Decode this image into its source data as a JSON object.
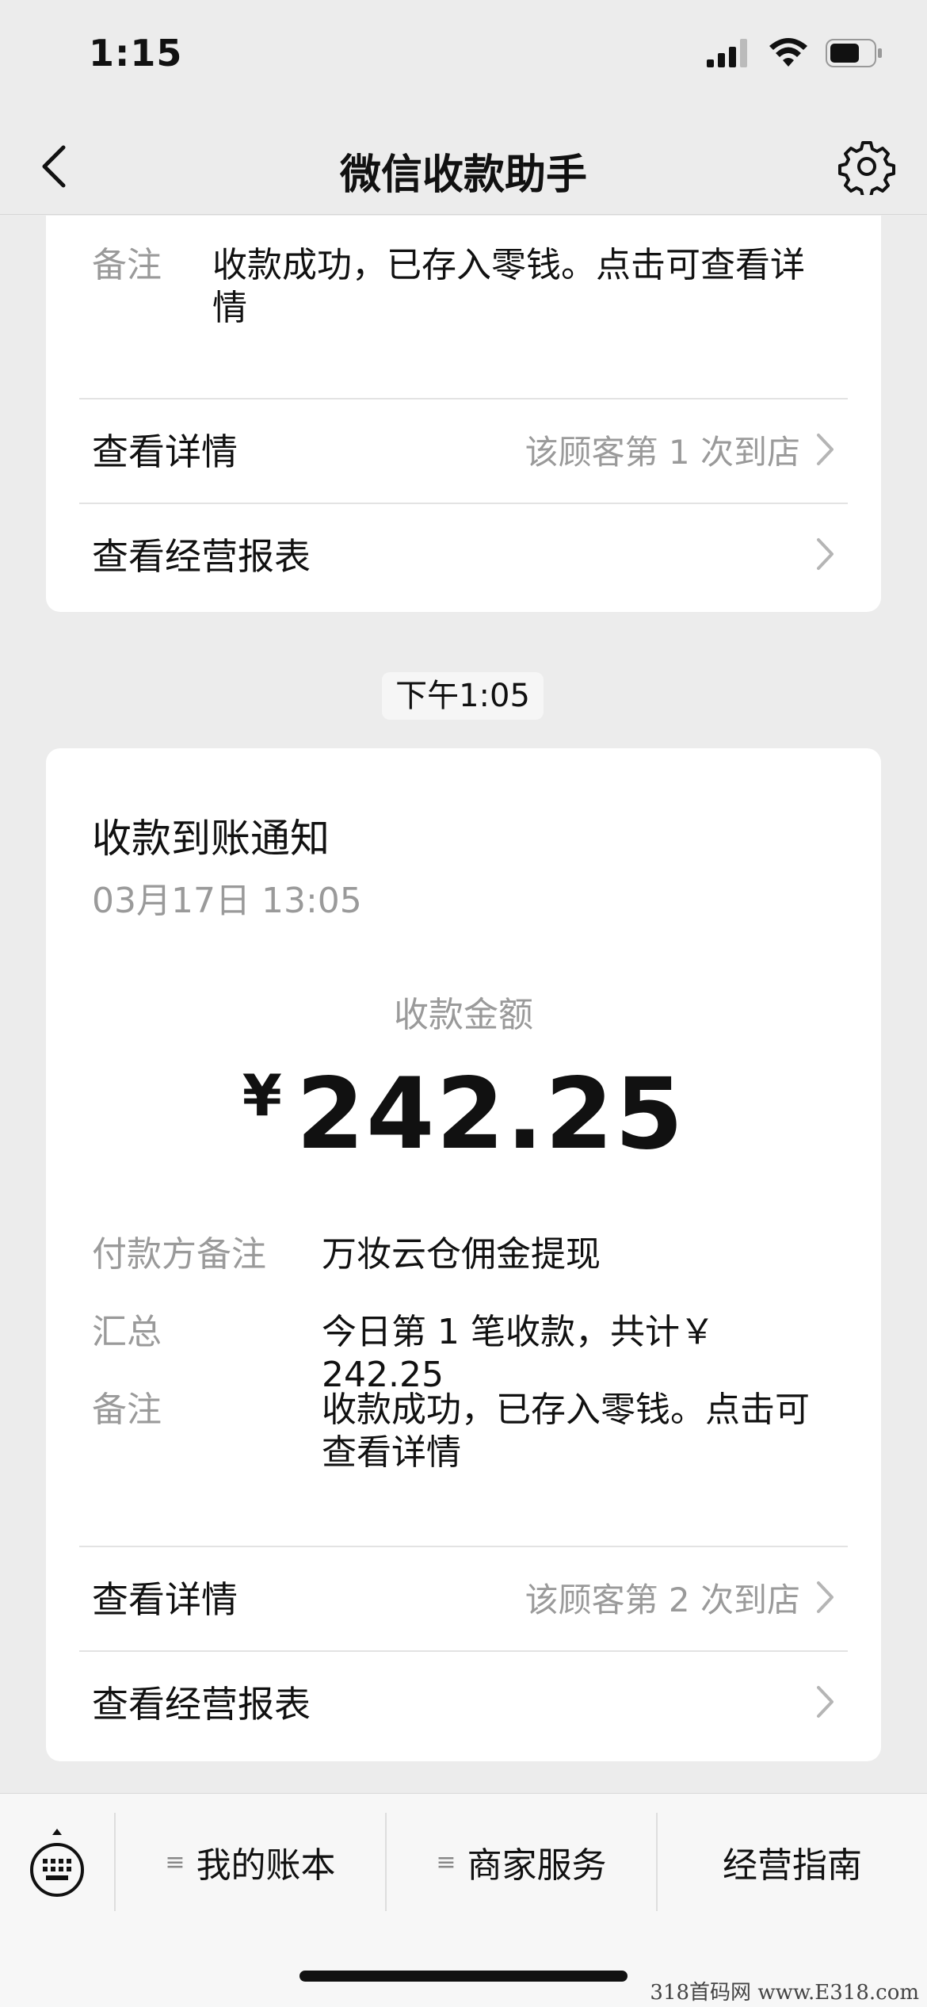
{
  "status_bar": {
    "time": "1:15"
  },
  "nav": {
    "title": "微信收款助手"
  },
  "top_card": {
    "note_label": "备注",
    "note_value": "收款成功，已存入零钱。点击可查看详情",
    "detail_link": {
      "label": "查看详情",
      "hint": "该顾客第 1 次到店"
    },
    "report_link": {
      "label": "查看经营报表"
    }
  },
  "timestamp": "下午1:05",
  "main_card": {
    "title": "收款到账通知",
    "date": "03月17日 13:05",
    "amount_label": "收款金额",
    "currency_symbol": "¥",
    "amount": "242.25",
    "details": [
      {
        "label": "付款方备注",
        "value": "万妆云仓佣金提现"
      },
      {
        "label": "汇总",
        "value": "今日第 1 笔收款，共计￥ 242.25"
      },
      {
        "label": "备注",
        "value": "收款成功，已存入零钱。点击可查看详情"
      }
    ],
    "detail_link": {
      "label": "查看详情",
      "hint": "该顾客第 2 次到店"
    },
    "report_link": {
      "label": "查看经营报表"
    }
  },
  "bottom_menu": {
    "items": [
      {
        "label": "我的账本",
        "glyph": "≡"
      },
      {
        "label": "商家服务",
        "glyph": "≡"
      },
      {
        "label": "经营指南",
        "glyph": ""
      }
    ]
  },
  "watermark": "318首码网 www.E318.com"
}
